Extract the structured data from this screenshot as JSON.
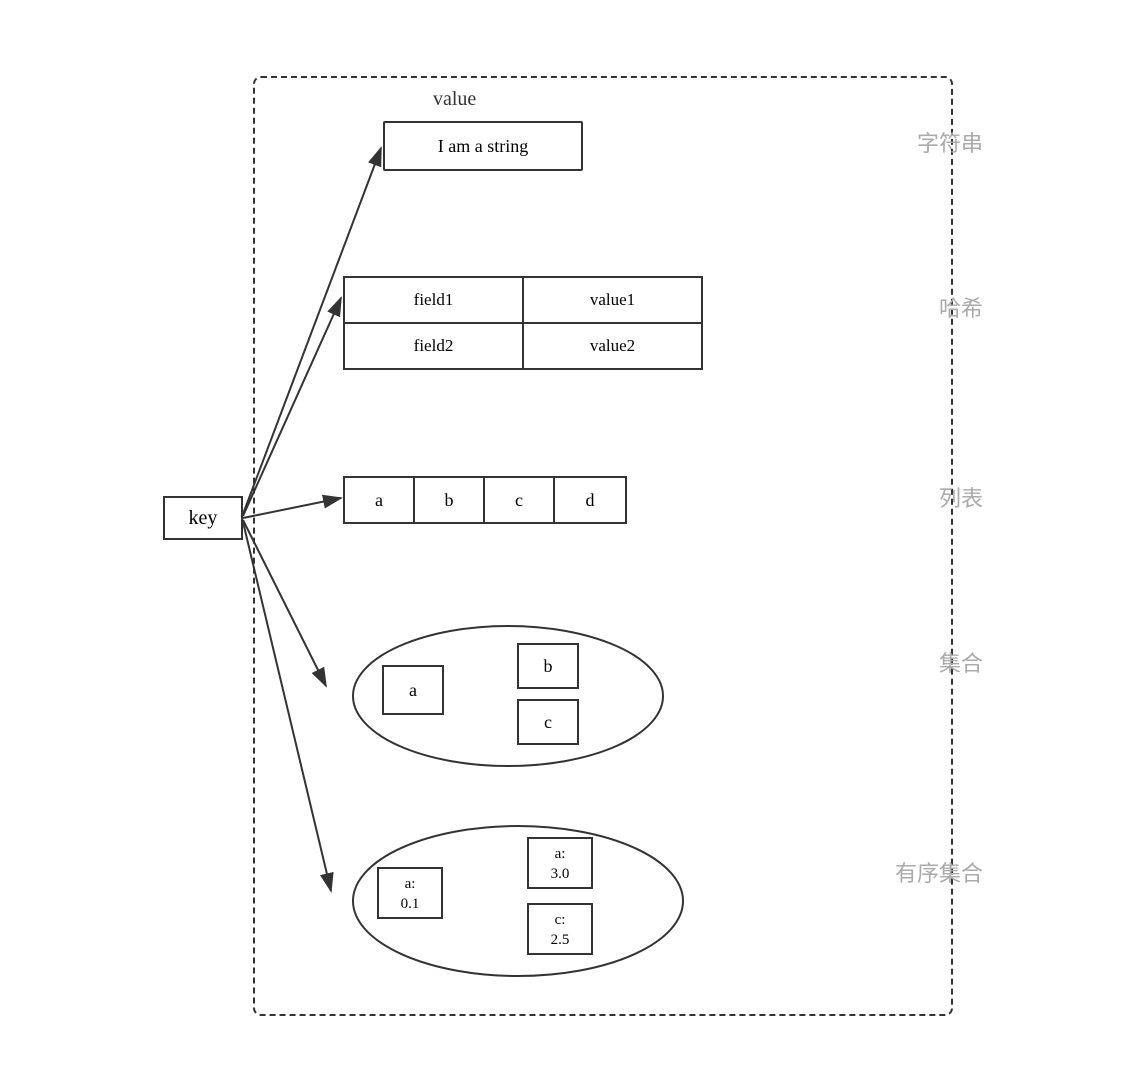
{
  "diagram": {
    "key_label": "key",
    "value_label": "value",
    "string": {
      "content": "I am a string",
      "chinese": "字符串"
    },
    "hash": {
      "chinese": "哈希",
      "rows": [
        {
          "field": "field1",
          "value": "value1"
        },
        {
          "field": "field2",
          "value": "value2"
        }
      ]
    },
    "list": {
      "chinese": "列表",
      "items": [
        "a",
        "b",
        "c",
        "d"
      ]
    },
    "set": {
      "chinese": "集合",
      "items": [
        "a",
        "b",
        "c"
      ]
    },
    "zset": {
      "chinese": "有序集合",
      "items": [
        {
          "key": "a:",
          "score": "0.1"
        },
        {
          "key": "a:",
          "score": "3.0"
        },
        {
          "key": "c:",
          "score": "2.5"
        }
      ]
    }
  }
}
